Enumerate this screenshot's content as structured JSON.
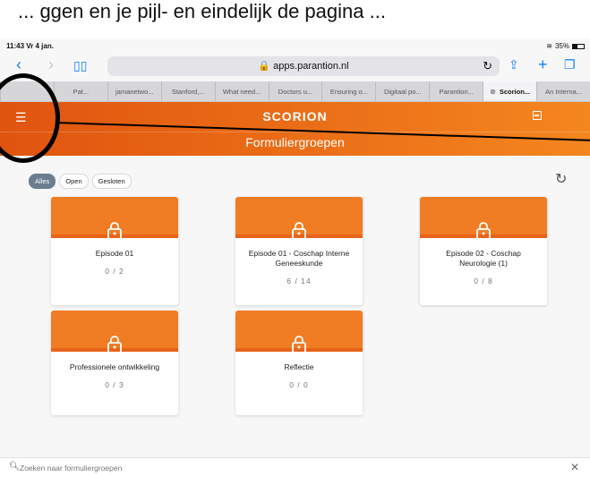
{
  "banner": {
    "text": "... ggen en je pijl- en eindelijk de pagina ..."
  },
  "status": {
    "time": "11:43",
    "date": "Vr 4 jan.",
    "battery": "35%"
  },
  "browser": {
    "url": "apps.parantion.nl",
    "tabs": [
      {
        "label": "",
        "active": false
      },
      {
        "label": "Pat...",
        "active": false
      },
      {
        "label": "jamanetwo...",
        "active": false
      },
      {
        "label": "Stanford,...",
        "active": false
      },
      {
        "label": "What need...",
        "active": false
      },
      {
        "label": "Doctors u...",
        "active": false
      },
      {
        "label": "Ensuring o...",
        "active": false
      },
      {
        "label": "Digitaal po...",
        "active": false
      },
      {
        "label": "Parantion...",
        "active": false
      },
      {
        "label": "Scorion...",
        "active": true
      },
      {
        "label": "An Interna...",
        "active": false
      }
    ]
  },
  "app": {
    "brand": "SCORION",
    "page_title": "Formuliergroepen",
    "accent": "#f07c24"
  },
  "filters": [
    {
      "label": "Alles",
      "active": true
    },
    {
      "label": "Open",
      "active": false
    },
    {
      "label": "Gesloten",
      "active": false
    }
  ],
  "cards": [
    {
      "title": "Episode 01",
      "count": "0 / 2"
    },
    {
      "title": "Episode 01 - Coschap Interne Geneeskunde",
      "count": "6 / 14"
    },
    {
      "title": "Episode 02 - Coschap Neurologie (1)",
      "count": "0 / 8"
    },
    {
      "title": "Professionele ontwikkeling",
      "count": "0 / 3"
    },
    {
      "title": "Reflectie",
      "count": "0 / 0"
    }
  ],
  "search": {
    "placeholder": "Zoeken naar formuliergroepen"
  }
}
